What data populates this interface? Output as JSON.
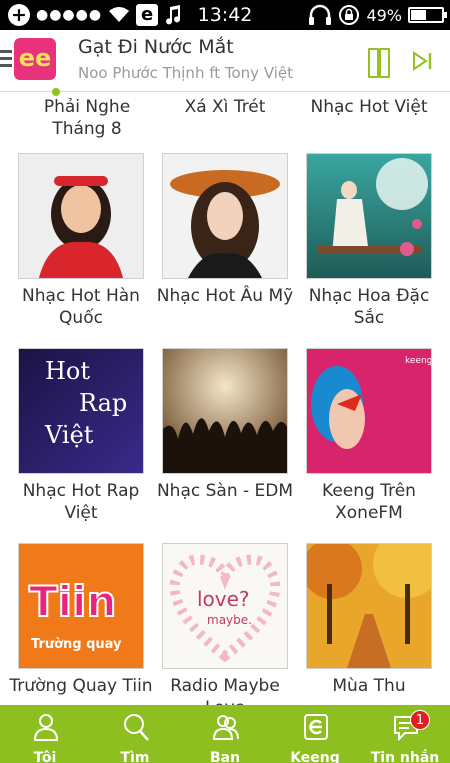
{
  "status_bar": {
    "time": "13:42",
    "battery": "49%",
    "battery_level": 0.49,
    "signal": "●●●●●"
  },
  "now_playing": {
    "logo_text": "ee",
    "title": "Gạt Đi Nước Mắt",
    "artist": "Noo Phước Thịnh ft Tony Việt"
  },
  "grid": {
    "partial_row": [
      "Phải Nghe\nTháng 8",
      "Xá Xì Trét",
      "Nhạc Hot Việt"
    ],
    "tiles": [
      {
        "caption": "Nhạc Hot Hàn Quốc"
      },
      {
        "caption": "Nhạc Hot Âu Mỹ"
      },
      {
        "caption": "Nhạc Hoa Đặc Sắc"
      },
      {
        "caption": "Nhạc Hot Rap Việt",
        "art_text": [
          "Hot",
          "Rap",
          "Việt"
        ]
      },
      {
        "caption": "Nhạc Sàn - EDM"
      },
      {
        "caption": "Keeng Trên XoneFM",
        "art_text": [
          "keeng"
        ]
      },
      {
        "caption": "Trường Quay Tiin",
        "art_text": [
          "Tiin",
          "Trường quay"
        ]
      },
      {
        "caption": "Radio Maybe Love",
        "art_text": [
          "love?",
          "maybe."
        ]
      },
      {
        "caption": "Mùa Thu"
      }
    ]
  },
  "bottom_nav": [
    {
      "label": "Tôi",
      "icon": "user-icon"
    },
    {
      "label": "Tìm",
      "icon": "search-icon"
    },
    {
      "label": "Bạn",
      "icon": "friends-icon"
    },
    {
      "label": "Keeng",
      "icon": "keeng-logo-icon"
    },
    {
      "label": "Tin nhắn",
      "icon": "message-icon",
      "badge": "1"
    }
  ],
  "colors": {
    "accent": "#8cbf1f",
    "logo_pink": "#e8327c"
  }
}
